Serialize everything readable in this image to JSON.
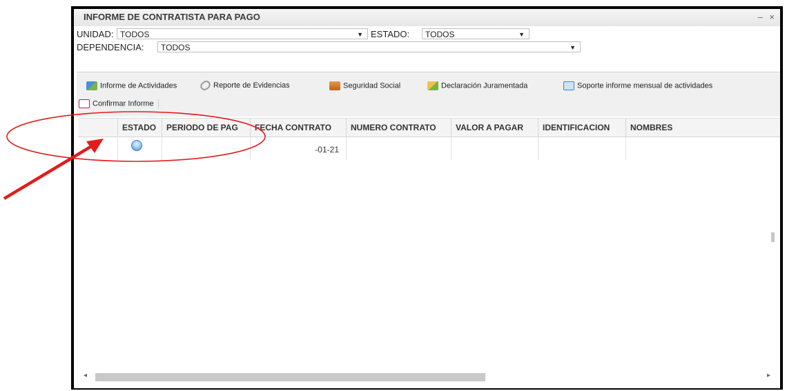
{
  "window": {
    "title": "INFORME DE CONTRATISTA PARA PAGO",
    "minimize": "–",
    "close": "×"
  },
  "filters": {
    "unidad_label": "UNIDAD:",
    "unidad_value": "TODOS",
    "estado_label": "ESTADO:",
    "estado_value": "TODOS",
    "dependencia_label": "DEPENDENCIA:",
    "dependencia_value": "TODOS",
    "arrow": "▼"
  },
  "toolbar": {
    "items": [
      {
        "label": "Informe de Actividades",
        "icon": "report-icon",
        "color": "#4a90d9"
      },
      {
        "label": "Reporte de Evidencias",
        "icon": "paperclip-icon",
        "color": "#8a8a8a"
      },
      {
        "label": "Seguridad Social",
        "icon": "briefcase-icon",
        "color": "#d9822b"
      },
      {
        "label": "Declaración Juramentada",
        "icon": "certificate-icon",
        "color": "#7cb342"
      },
      {
        "label": "Soporte informe mensual de actividades",
        "icon": "book-icon",
        "color": "#3f7fd1"
      },
      {
        "label": "Confirmar Informe",
        "icon": "edit-checklist-icon",
        "color": "#c2185b"
      }
    ]
  },
  "grid": {
    "columns": [
      "ESTADO",
      "PERIODO DE PAG",
      "FECHA CONTRATO",
      "NUMERO CONTRATO",
      "VALOR A PAGAR",
      "IDENTIFICACION",
      "NOMBRES"
    ],
    "rows": [
      {
        "estado": "status-circle-icon",
        "periodo": "",
        "fecha": "-01-21",
        "numero": "",
        "valor": "",
        "identificacion": "",
        "nombres": ""
      }
    ]
  },
  "scroll": {
    "left": "◂",
    "right": "▸"
  },
  "annotation_color": "#e31b1b"
}
